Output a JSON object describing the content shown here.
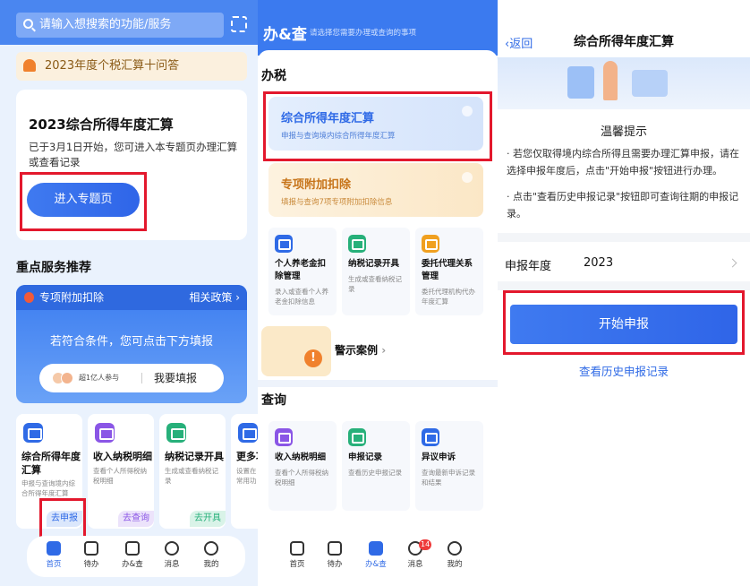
{
  "colors": {
    "primary": "#2f6ae6",
    "highlight": "#e3182d",
    "warning": "#f0812d"
  },
  "home": {
    "search": {
      "placeholder": "请输入想搜索的功能/服务"
    },
    "notice": "2023年度个税汇算十问答",
    "feature": {
      "title": "2023综合所得年度汇算",
      "desc": "已于3月1日开始，您可进入本专题页办理汇算或查看记录",
      "button": "进入专题页"
    },
    "section": "重点服务推荐",
    "deduction": {
      "title": "专项附加扣除",
      "policy": "相关政策 ›",
      "message": "若符合条件，您可点击下方填报",
      "participants": "超1亿人参与",
      "button": "我要填报"
    },
    "services": [
      {
        "title": "综合所得年度汇算",
        "desc": "申报与查询境内综合所得年度汇算",
        "tag": "去申报",
        "icon": "tax-report-icon",
        "color": "#2f6ae6"
      },
      {
        "title": "收入纳税明细",
        "desc": "查看个人所得税纳税明细",
        "tag": "去查询",
        "icon": "income-detail-icon",
        "color": "#8a56e6"
      },
      {
        "title": "纳税记录开具",
        "desc": "生成或查看纳税记录",
        "tag": "去开具",
        "icon": "tax-record-icon",
        "color": "#27b07a"
      },
      {
        "title": "更多功",
        "desc": "设置在常用功",
        "tag": "",
        "icon": "more-icon",
        "color": "#2f6ae6"
      }
    ],
    "tabs": [
      {
        "label": "首页",
        "icon": "home-icon"
      },
      {
        "label": "待办",
        "icon": "todo-icon"
      },
      {
        "label": "办&查",
        "icon": "handle-query-icon"
      },
      {
        "label": "消息",
        "icon": "message-icon"
      },
      {
        "label": "我的",
        "icon": "profile-icon"
      }
    ]
  },
  "handle": {
    "title": "办&查",
    "subtitle": "请选择您需要办理或查询的事项",
    "tax_section": "办税",
    "annual": {
      "title": "综合所得年度汇算",
      "desc": "申报与查询境内综合所得年度汇算"
    },
    "special": {
      "title": "专项附加扣除",
      "desc": "填报与查询7项专项附加扣除信息"
    },
    "tax_items": [
      {
        "title": "个人养老金扣除管理",
        "desc": "录入或查看个人养老金扣除信息",
        "icon": "pension-icon",
        "color": "#2f6ae6"
      },
      {
        "title": "纳税记录开具",
        "desc": "生成或查看纳税记录",
        "icon": "tax-record-icon",
        "color": "#27b07a"
      },
      {
        "title": "委托代理关系管理",
        "desc": "委托代理机构代办年度汇算",
        "icon": "agent-icon",
        "color": "#f0a020"
      }
    ],
    "warning_case": "警示案例",
    "query_section": "查询",
    "query_items": [
      {
        "title": "收入纳税明细",
        "desc": "查看个人所得税纳税明细",
        "icon": "income-detail-icon",
        "color": "#8a56e6"
      },
      {
        "title": "申报记录",
        "desc": "查看历史申报记录",
        "icon": "report-record-icon",
        "color": "#27b07a"
      },
      {
        "title": "异议申诉",
        "desc": "查询最新申诉记录和结果",
        "icon": "appeal-icon",
        "color": "#2f6ae6"
      }
    ],
    "tabs": [
      {
        "label": "首页",
        "icon": "home-icon"
      },
      {
        "label": "待办",
        "icon": "todo-icon"
      },
      {
        "label": "办&查",
        "icon": "handle-query-icon"
      },
      {
        "label": "消息",
        "icon": "message-icon",
        "badge": "14"
      },
      {
        "label": "我的",
        "icon": "profile-icon"
      }
    ]
  },
  "annual": {
    "back": "返回",
    "title": "综合所得年度汇算",
    "tip_title": "温馨提示",
    "tips": [
      "若您仅取得境内综合所得且需要办理汇算申报，请在选择申报年度后，点击\"开始申报\"按钮进行办理。",
      "点击\"查看历史申报记录\"按钮即可查询往期的申报记录。"
    ],
    "year_label": "申报年度",
    "year_value": "2023",
    "start_button": "开始申报",
    "history_link": "查看历史申报记录"
  }
}
